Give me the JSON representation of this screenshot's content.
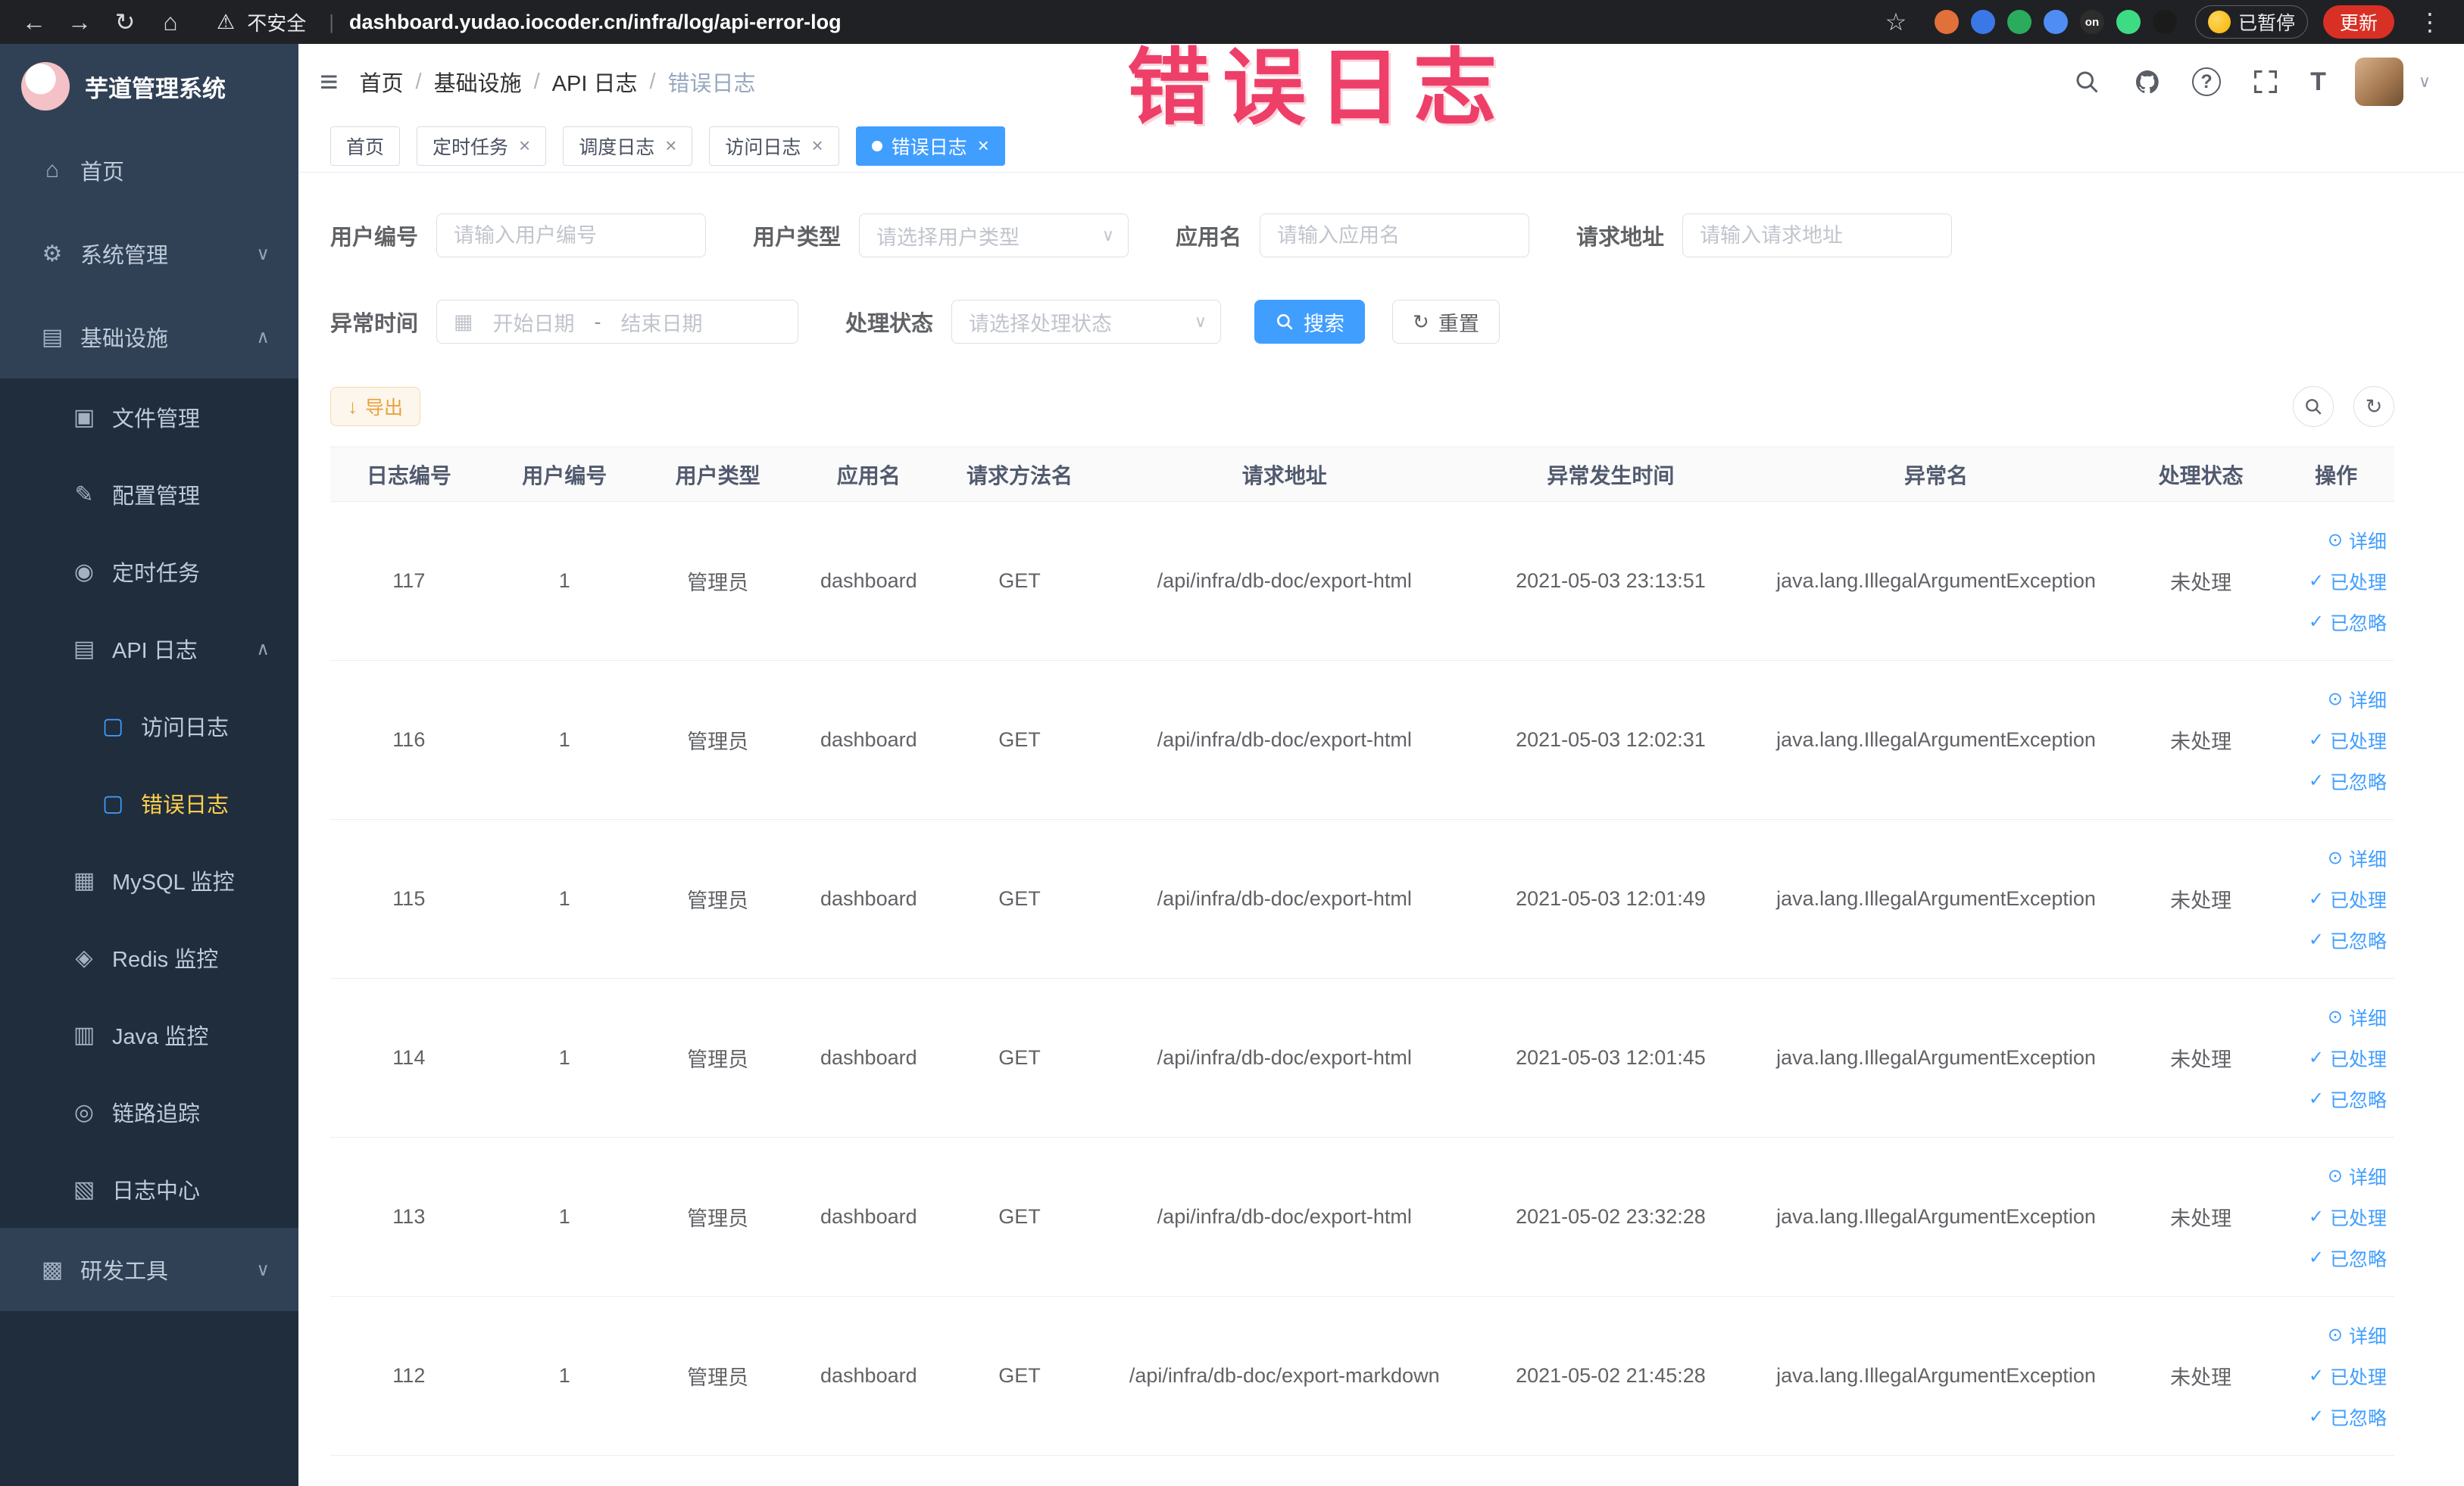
{
  "colors": {
    "primary": "#409eff",
    "warning": "#e6a23c",
    "annotation": "#ee3f68",
    "sidebar_bg": "#304156",
    "submenu_bg": "#1f2d3d",
    "active_menu_text": "#ffd04b"
  },
  "icons": {
    "back": "←",
    "forward": "→",
    "reload": "↻",
    "home": "⌂",
    "warning": "⚠",
    "star": "☆",
    "kebab": "⋮",
    "hamburger": "≡",
    "question": "?",
    "caret": "∨",
    "calendar": "▦",
    "download": "↓",
    "view": "⊙",
    "check": "✓",
    "chevron_down": "∨",
    "chevron_up": "∧",
    "font_size": "T",
    "menu_home": "⌂",
    "menu_gear": "⚙",
    "menu_infra": "▤",
    "menu_folder": "▣",
    "menu_config": "✎",
    "menu_timer": "◉",
    "menu_apilog": "▤",
    "menu_doc": "▢",
    "menu_mysql": "▦",
    "menu_redis": "◈",
    "menu_java": "▥",
    "menu_trace": "◎",
    "menu_logcenter": "▧",
    "menu_tools": "▩"
  },
  "browser": {
    "security_label": "不安全",
    "separator": "|",
    "url": "dashboard.yudao.iocoder.cn/infra/log/api-error-log",
    "paused_badge": "已暂停",
    "update_label": "更新",
    "extensions": [
      {
        "color": "#e2703a",
        "text": ""
      },
      {
        "color": "#3b78e7",
        "text": ""
      },
      {
        "color": "#2bab5c",
        "text": ""
      },
      {
        "color": "#4f8df5",
        "text": ""
      },
      {
        "color": "#2d2d2d",
        "text": "on"
      },
      {
        "color": "#3ddc84",
        "text": ""
      },
      {
        "color": "#1b1b1b",
        "text": ""
      }
    ]
  },
  "annotation": {
    "text": "错误日志"
  },
  "sidebar": {
    "logo_title": "芋道管理系统",
    "items": [
      {
        "name": "home",
        "label": "首页",
        "icon": "menu_home",
        "icon_name": "home-icon",
        "level": 1
      },
      {
        "name": "system-management",
        "label": "系统管理",
        "icon": "menu_gear",
        "icon_name": "gear-icon",
        "level": 1,
        "chevron": "down"
      },
      {
        "name": "infrastructure",
        "label": "基础设施",
        "icon": "menu_infra",
        "icon_name": "infrastructure-icon",
        "level": 1,
        "chevron": "up"
      },
      {
        "name": "file-management",
        "label": "文件管理",
        "icon": "menu_folder",
        "icon_name": "folder-icon",
        "level": 2
      },
      {
        "name": "config-management",
        "label": "配置管理",
        "icon": "menu_config",
        "icon_name": "config-icon",
        "level": 2
      },
      {
        "name": "scheduled-tasks",
        "label": "定时任务",
        "icon": "menu_timer",
        "icon_name": "timer-icon",
        "level": 2
      },
      {
        "name": "api-log",
        "label": "API 日志",
        "icon": "menu_apilog",
        "icon_name": "api-log-icon",
        "level": 2,
        "chevron": "up"
      },
      {
        "name": "access-log",
        "label": "访问日志",
        "icon": "menu_doc",
        "icon_name": "document-icon",
        "level": 3,
        "blue": true
      },
      {
        "name": "error-log",
        "label": "错误日志",
        "icon": "menu_doc",
        "icon_name": "document-icon",
        "level": 3,
        "blue": true,
        "active": true
      },
      {
        "name": "mysql-monitor",
        "label": "MySQL 监控",
        "icon": "menu_mysql",
        "icon_name": "mysql-icon",
        "level": 2
      },
      {
        "name": "redis-monitor",
        "label": "Redis 监控",
        "icon": "menu_redis",
        "icon_name": "redis-icon",
        "level": 2
      },
      {
        "name": "java-monitor",
        "label": "Java 监控",
        "icon": "menu_java",
        "icon_name": "java-icon",
        "level": 2
      },
      {
        "name": "trace",
        "label": "链路追踪",
        "icon": "menu_trace",
        "icon_name": "trace-icon",
        "level": 2
      },
      {
        "name": "log-center",
        "label": "日志中心",
        "icon": "menu_logcenter",
        "icon_name": "log-center-icon",
        "level": 2
      },
      {
        "name": "dev-tools",
        "label": "研发工具",
        "icon": "menu_tools",
        "icon_name": "tools-icon",
        "level": 1,
        "chevron": "down"
      }
    ]
  },
  "header": {
    "breadcrumb": [
      "首页",
      "基础设施",
      "API 日志",
      "错误日志"
    ]
  },
  "tabs": [
    {
      "name": "home",
      "label": "首页",
      "closable": false,
      "active": false
    },
    {
      "name": "timed-task",
      "label": "定时任务",
      "closable": true,
      "active": false
    },
    {
      "name": "schedule-log",
      "label": "调度日志",
      "closable": true,
      "active": false
    },
    {
      "name": "access-log",
      "label": "访问日志",
      "closable": true,
      "active": false
    },
    {
      "name": "error-log",
      "label": "错误日志",
      "closable": true,
      "active": true
    }
  ],
  "filters": {
    "user_id_label": "用户编号",
    "user_id_placeholder": "请输入用户编号",
    "user_type_label": "用户类型",
    "user_type_placeholder": "请选择用户类型",
    "app_name_label": "应用名",
    "app_name_placeholder": "请输入应用名",
    "request_url_label": "请求地址",
    "request_url_placeholder": "请输入请求地址",
    "exception_time_label": "异常时间",
    "date_start_placeholder": "开始日期",
    "date_separator": "-",
    "date_end_placeholder": "结束日期",
    "process_status_label": "处理状态",
    "process_status_placeholder": "请选择处理状态",
    "search_label": "搜索",
    "reset_label": "重置"
  },
  "toolbar": {
    "export_label": "导出"
  },
  "table": {
    "columns": [
      "日志编号",
      "用户编号",
      "用户类型",
      "应用名",
      "请求方法名",
      "请求地址",
      "异常发生时间",
      "异常名",
      "处理状态",
      "操作"
    ],
    "action_labels": [
      "详细",
      "已处理",
      "已忽略"
    ],
    "action_names": [
      "detail",
      "processed",
      "ignored"
    ],
    "rows": [
      {
        "id": "117",
        "user_id": "1",
        "user_type": "管理员",
        "app": "dashboard",
        "method": "GET",
        "url": "/api/infra/db-doc/export-html",
        "time": "2021-05-03 23:13:51",
        "exception": "java.lang.IllegalArgumentException",
        "status": "未处理"
      },
      {
        "id": "116",
        "user_id": "1",
        "user_type": "管理员",
        "app": "dashboard",
        "method": "GET",
        "url": "/api/infra/db-doc/export-html",
        "time": "2021-05-03 12:02:31",
        "exception": "java.lang.IllegalArgumentException",
        "status": "未处理"
      },
      {
        "id": "115",
        "user_id": "1",
        "user_type": "管理员",
        "app": "dashboard",
        "method": "GET",
        "url": "/api/infra/db-doc/export-html",
        "time": "2021-05-03 12:01:49",
        "exception": "java.lang.IllegalArgumentException",
        "status": "未处理"
      },
      {
        "id": "114",
        "user_id": "1",
        "user_type": "管理员",
        "app": "dashboard",
        "method": "GET",
        "url": "/api/infra/db-doc/export-html",
        "time": "2021-05-03 12:01:45",
        "exception": "java.lang.IllegalArgumentException",
        "status": "未处理"
      },
      {
        "id": "113",
        "user_id": "1",
        "user_type": "管理员",
        "app": "dashboard",
        "method": "GET",
        "url": "/api/infra/db-doc/export-html",
        "time": "2021-05-02 23:32:28",
        "exception": "java.lang.IllegalArgumentException",
        "status": "未处理"
      },
      {
        "id": "112",
        "user_id": "1",
        "user_type": "管理员",
        "app": "dashboard",
        "method": "GET",
        "url": "/api/infra/db-doc/export-markdown",
        "time": "2021-05-02 21:45:28",
        "exception": "java.lang.IllegalArgumentException",
        "status": "未处理"
      }
    ]
  }
}
